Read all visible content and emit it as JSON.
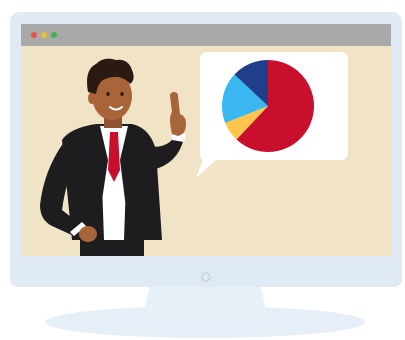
{
  "illustration": {
    "subject": "presenter-with-pie-chart-on-monitor",
    "icons": [
      "monitor-icon",
      "window-dots-icon",
      "pie-chart-icon",
      "speech-bubble-icon",
      "presenter-figure",
      "power-button-icon"
    ]
  },
  "colors": {
    "monitor_bezel": "#dfeaf4",
    "monitor_shadow": "#c8dbec",
    "stand": "#e6eff7",
    "screen_bg": "#f0e3c6",
    "titlebar": "#a9a9a9",
    "dot_red": "#e7504b",
    "dot_yellow": "#f2c12e",
    "dot_green": "#3fb24b",
    "bubble": "#ffffff",
    "suit": "#1d1d1f",
    "shirt": "#ffffff",
    "tie": "#c8102e",
    "skin": "#a8653a",
    "hair": "#2b1a12"
  },
  "chart_data": {
    "type": "pie",
    "title": "",
    "values": [
      62,
      7,
      18,
      13
    ],
    "colors": [
      "#c8102e",
      "#ffc54d",
      "#3ab6f0",
      "#1f3f8a"
    ],
    "start_angle_deg": -90
  }
}
